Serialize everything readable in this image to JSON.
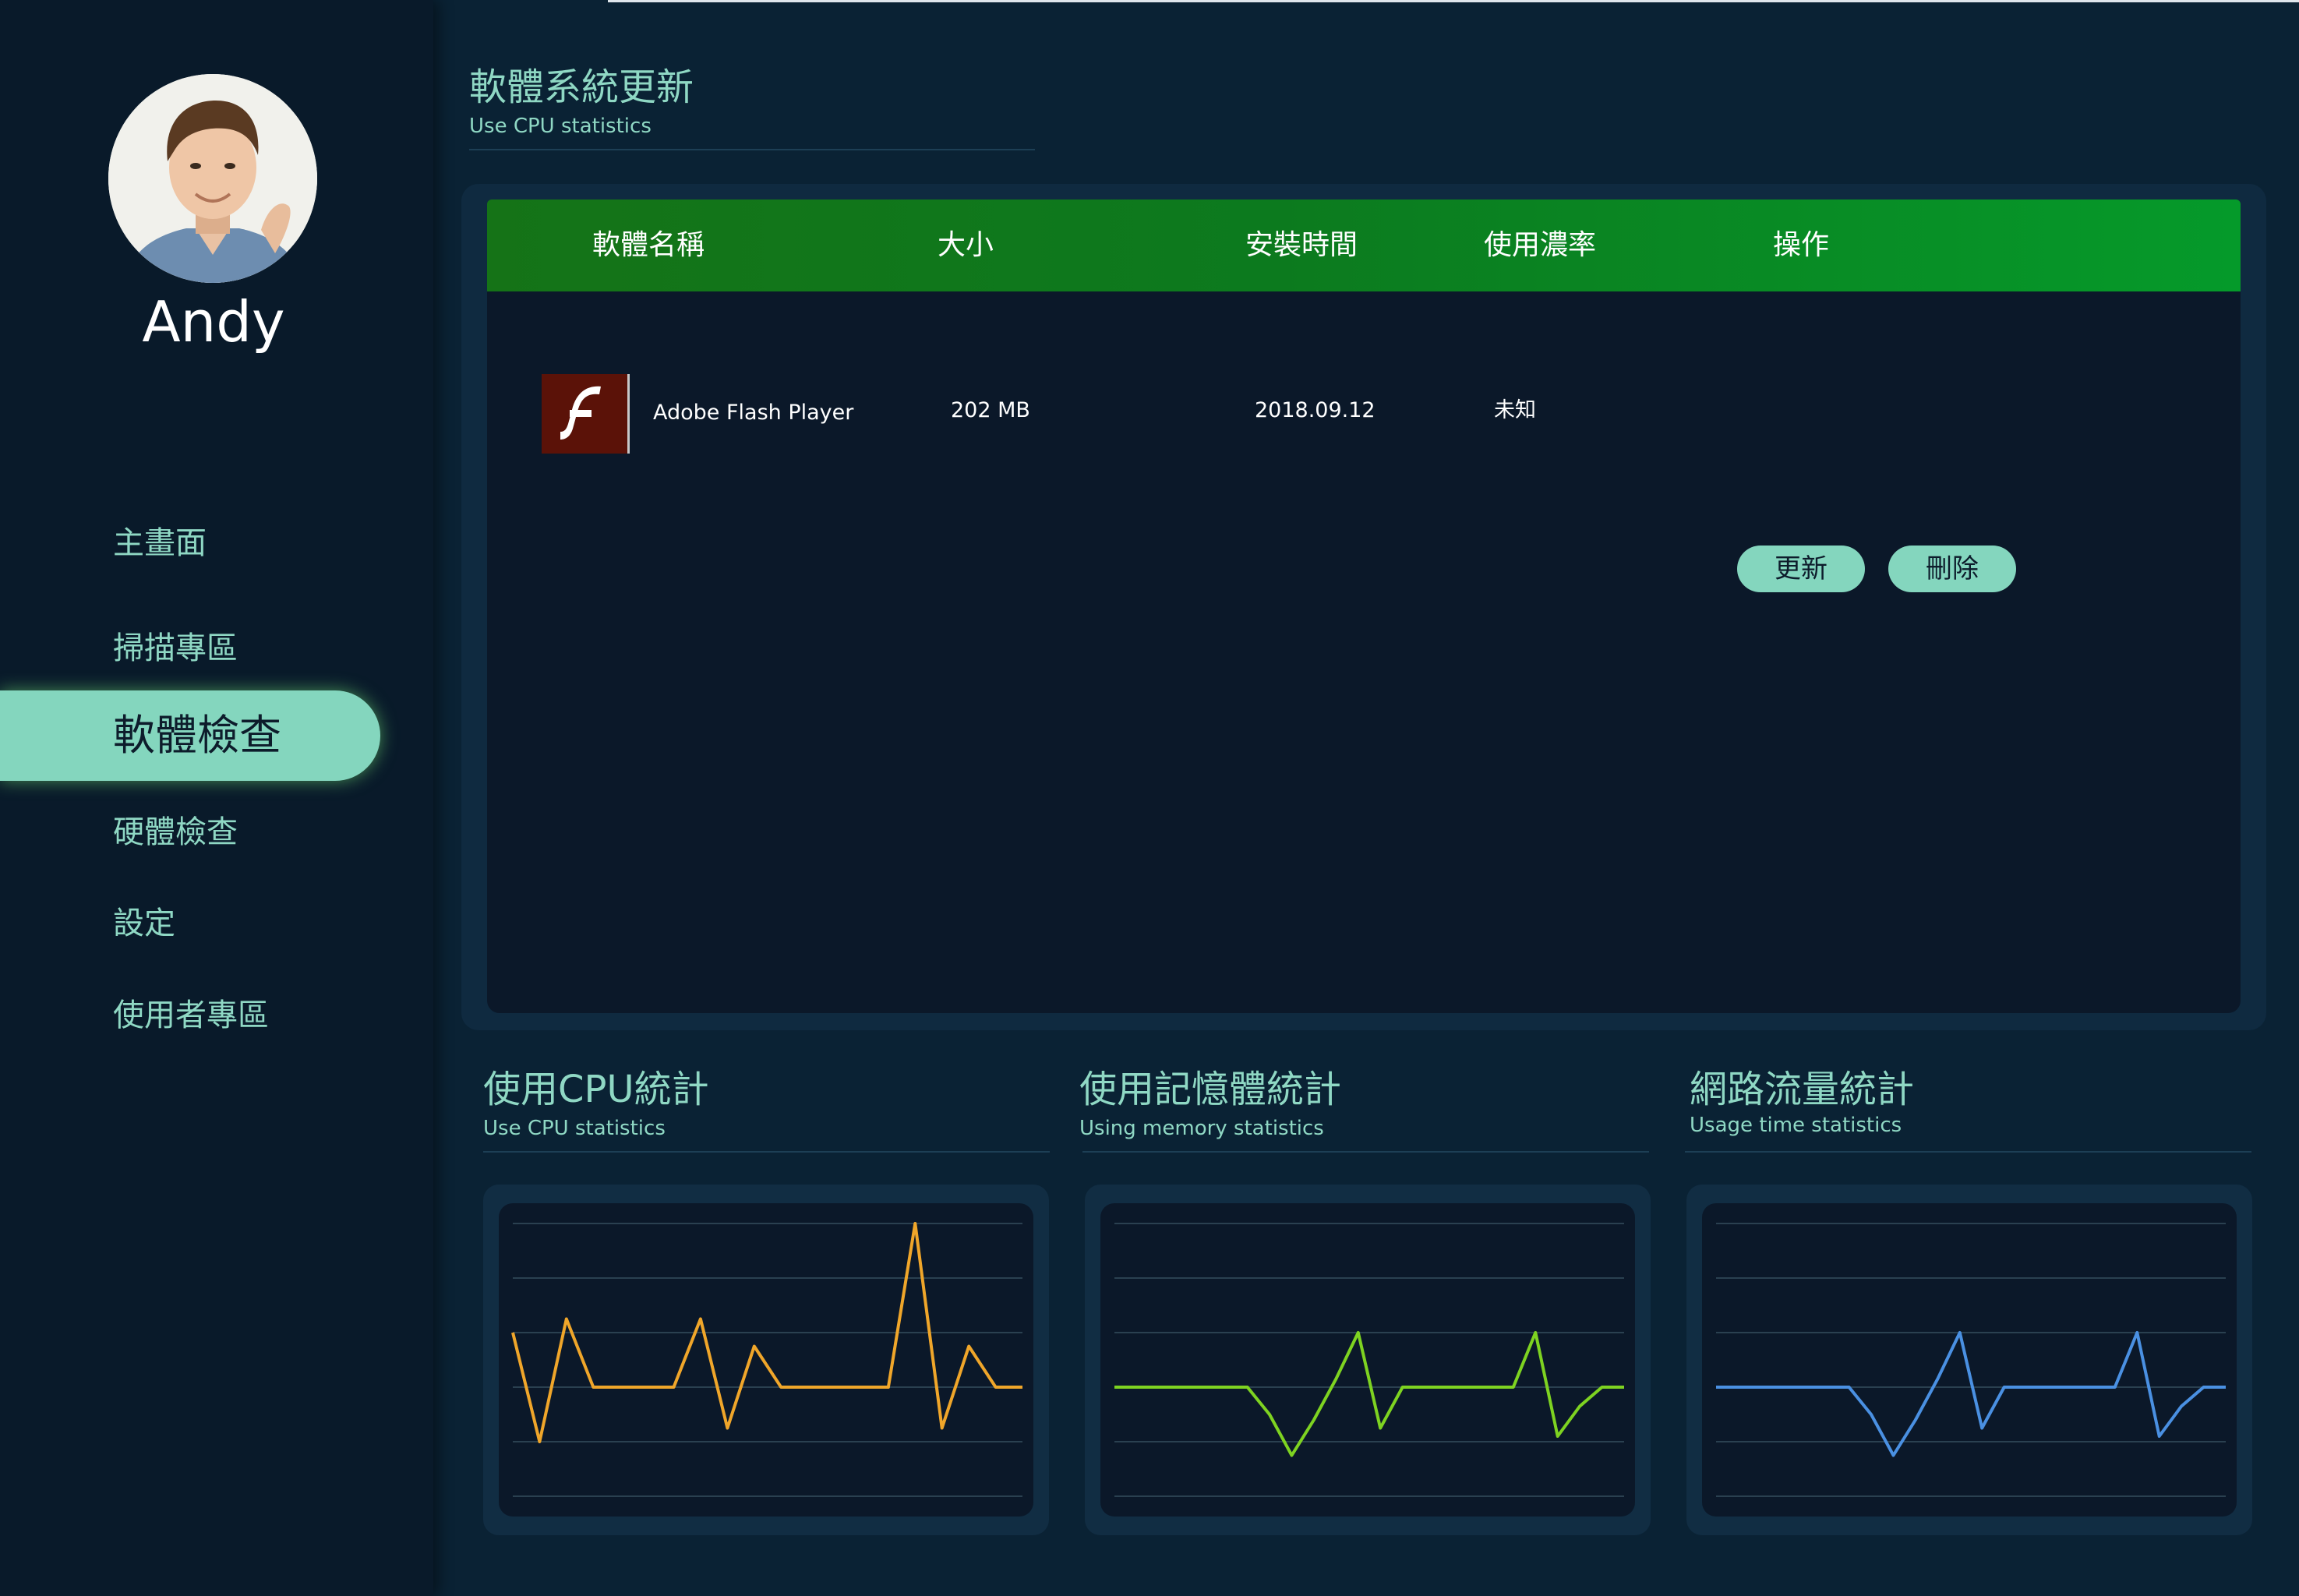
{
  "user": {
    "name": "Andy"
  },
  "nav": {
    "home": "主畫面",
    "scan": "掃描專區",
    "software_check": "軟體檢查",
    "hardware_check": "硬體檢查",
    "settings": "設定",
    "user_area": "使用者專區"
  },
  "section": {
    "title": "軟體系統更新",
    "subtitle": "Use CPU statistics"
  },
  "table": {
    "headers": [
      "軟體名稱",
      "大小",
      "安裝時間",
      "使用濃率",
      "操作"
    ],
    "rows": [
      {
        "name": "Adobe Flash Player",
        "size": "202 MB",
        "install_date": "2018.09.12",
        "usage": "未知",
        "icon": "flash-icon",
        "actions": [
          "更新",
          "刪除"
        ]
      }
    ]
  },
  "charts": {
    "cpu": {
      "title": "使用CPU統計",
      "subtitle": "Use CPU statistics"
    },
    "memory": {
      "title": "使用記憶體統計",
      "subtitle": "Using memory statistics"
    },
    "network": {
      "title": "網路流量統計",
      "subtitle": "Usage time statistics"
    }
  },
  "chart_data": [
    {
      "type": "line",
      "series": [
        {
          "values": [
            60,
            20,
            65,
            40,
            40,
            40,
            40,
            65,
            25,
            55,
            40,
            40,
            40,
            40,
            40,
            100,
            25,
            55,
            40,
            40
          ]
        }
      ],
      "grid": true,
      "color": "#f0a62a"
    },
    {
      "type": "line",
      "series": [
        {
          "values": [
            40,
            40,
            40,
            40,
            40,
            40,
            40,
            30,
            15,
            28,
            43,
            60,
            25,
            40,
            40,
            40,
            40,
            40,
            40,
            60,
            22,
            33,
            40,
            40
          ]
        }
      ],
      "grid": true,
      "color": "#7ed321"
    },
    {
      "type": "line",
      "series": [
        {
          "values": [
            40,
            40,
            40,
            40,
            40,
            40,
            40,
            30,
            15,
            28,
            43,
            60,
            25,
            40,
            40,
            40,
            40,
            40,
            40,
            60,
            22,
            33,
            40,
            40
          ]
        }
      ],
      "grid": true,
      "color": "#4a90e2"
    }
  ]
}
